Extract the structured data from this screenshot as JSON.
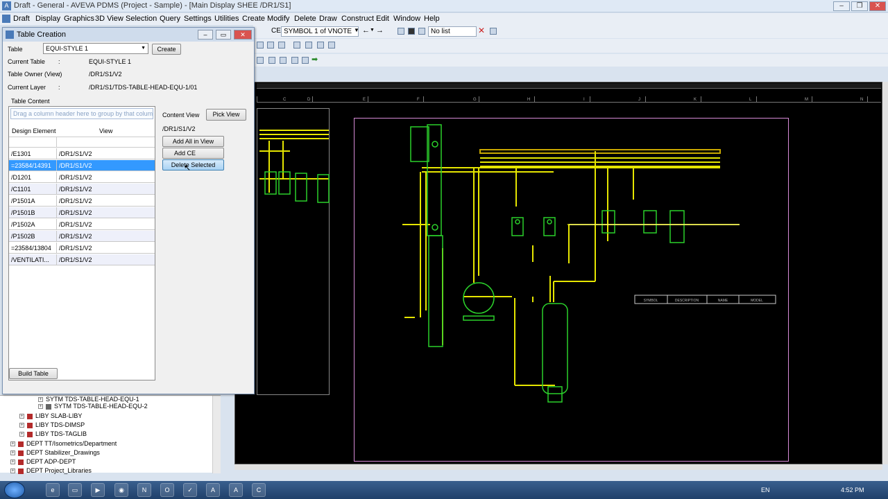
{
  "window": {
    "title": "Draft - General -  AVEVA PDMS (Project - Sample) - [Main Display  SHEE  /DR1/S1]",
    "minimize": "▭",
    "maximize": "❐",
    "close": "✕"
  },
  "menu": [
    "Draft",
    "Display",
    "Graphics",
    "3D View",
    "Selection",
    "Query",
    "Settings",
    "Utilities",
    "Create",
    "Modify",
    "Delete",
    "Draw",
    "Construct",
    "Edit",
    "Window",
    "Help"
  ],
  "toolbar": {
    "ce_label": "CE",
    "ce_value": "SYMBOL 1 of VNOTE",
    "list_value": "No list"
  },
  "dialog": {
    "title": "Table Creation",
    "table_label": "Table",
    "table_value": "EQUI-STYLE 1",
    "create_button": "Create",
    "current_table_label": "Current Table",
    "current_table_value": "EQUI-STYLE 1",
    "table_owner_label": "Table Owner (View)",
    "table_owner_value": "/DR1/S1/V2",
    "current_layer_label": "Current Layer",
    "current_layer_value": "/DR1/S1/TDS-TABLE-HEAD-EQU-1/01",
    "colon": ":",
    "table_content_label": "Table Content",
    "group_hint": "Drag a column header here to group by that column",
    "col_design_element": "Design Element",
    "col_view": "View",
    "content_view_label": "Content View",
    "pick_view_button": "Pick View",
    "content_view_value": "/DR1/S1/V2",
    "add_all_button": "Add All in View",
    "add_ce_button": "Add CE",
    "delete_selected_button": "Delete Selected",
    "build_table_button": "Build Table",
    "rows": [
      {
        "element": "/E1301",
        "view": "/DR1/S1/V2"
      },
      {
        "element": "=23584/14391",
        "view": "/DR1/S1/V2"
      },
      {
        "element": "/D1201",
        "view": "/DR1/S1/V2"
      },
      {
        "element": "/C1101",
        "view": "/DR1/S1/V2"
      },
      {
        "element": "/P1501A",
        "view": "/DR1/S1/V2"
      },
      {
        "element": "/P1501B",
        "view": "/DR1/S1/V2"
      },
      {
        "element": "/P1502A",
        "view": "/DR1/S1/V2"
      },
      {
        "element": "/P1502B",
        "view": "/DR1/S1/V2"
      },
      {
        "element": "=23584/13804",
        "view": "/DR1/S1/V2"
      },
      {
        "element": "/VENTILATI...",
        "view": "/DR1/S1/V2"
      }
    ]
  },
  "tree": [
    {
      "text": "SYTM TDS-TABLE-HEAD-EQU-1",
      "level": 3
    },
    {
      "text": "SYTM TDS-TABLE-HEAD-EQU-2",
      "level": 3
    },
    {
      "text": "LIBY SLAB-LIBY",
      "level": 1
    },
    {
      "text": "LIBY TDS-DIMSP",
      "level": 1
    },
    {
      "text": "LIBY TDS-TAGLIB",
      "level": 1
    },
    {
      "text": "DEPT TT/Isometrics/Department",
      "level": 0
    },
    {
      "text": "DEPT Stabilizer_Drawings",
      "level": 0
    },
    {
      "text": "DEPT ADP-DEPT",
      "level": 0
    },
    {
      "text": "DEPT Project_Libraries",
      "level": 0
    }
  ],
  "drawing_table_headers": [
    "SYMBOL",
    "DESCRIPTION",
    "NAME",
    "MODEL"
  ],
  "ruler_letters": [
    "C",
    "D",
    "E",
    "F",
    "G",
    "H",
    "I",
    "J",
    "K",
    "L",
    "M",
    "N"
  ],
  "taskbar": {
    "language": "EN",
    "time": "4:52 PM"
  },
  "colors": {
    "drawing_bg": "#000000",
    "pipe_yellow": "#e6e600",
    "equipment_green": "#2bd12b",
    "sheet_border": "#d98cd9",
    "selection": "#3399ff"
  }
}
